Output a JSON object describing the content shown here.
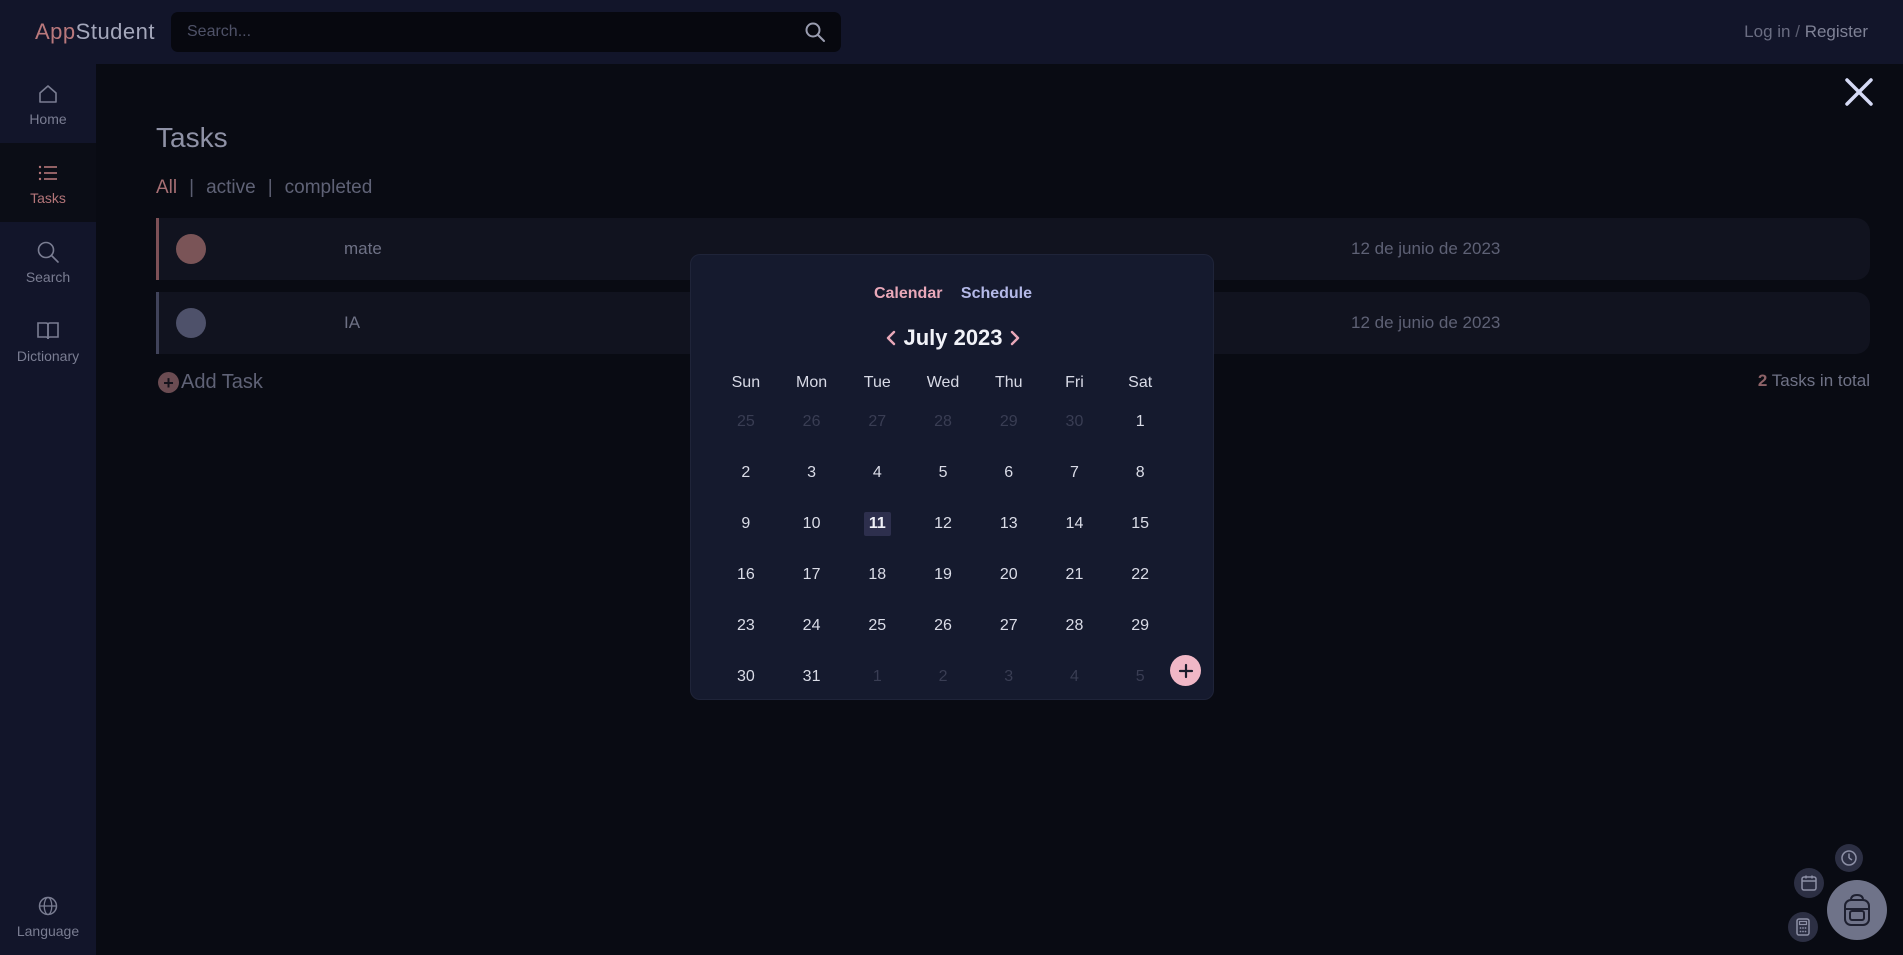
{
  "app": {
    "name_prefix": "App",
    "name_suffix": "Student"
  },
  "search": {
    "placeholder": "Search..."
  },
  "auth": {
    "login": "Log in",
    "separator": "/",
    "register": "Register"
  },
  "sidebar": {
    "items": [
      {
        "label": "Home",
        "icon": "home-icon"
      },
      {
        "label": "Tasks",
        "icon": "list-icon",
        "active": true
      },
      {
        "label": "Search",
        "icon": "search-icon"
      },
      {
        "label": "Dictionary",
        "icon": "book-icon"
      }
    ],
    "language": {
      "label": "Language",
      "icon": "globe-icon"
    }
  },
  "tasks": {
    "title": "Tasks",
    "filters": {
      "all": "All",
      "active": "active",
      "completed": "completed",
      "separator": "|"
    },
    "items": [
      {
        "name": "mate",
        "date": "12 de junio de 2023"
      },
      {
        "name": "IA",
        "date": "12 de junio de 2023"
      }
    ],
    "add_label": "Add Task",
    "total_count": "2",
    "total_label": "Tasks in total"
  },
  "calendar": {
    "tab_calendar": "Calendar",
    "tab_schedule": "Schedule",
    "month_label": "July 2023",
    "weekdays": [
      "Sun",
      "Mon",
      "Tue",
      "Wed",
      "Thu",
      "Fri",
      "Sat"
    ],
    "weeks": [
      [
        "25",
        "26",
        "27",
        "28",
        "29",
        "30",
        "1"
      ],
      [
        "2",
        "3",
        "4",
        "5",
        "6",
        "7",
        "8"
      ],
      [
        "9",
        "10",
        "11",
        "12",
        "13",
        "14",
        "15"
      ],
      [
        "16",
        "17",
        "18",
        "19",
        "20",
        "21",
        "22"
      ],
      [
        "23",
        "24",
        "25",
        "26",
        "27",
        "28",
        "29"
      ],
      [
        "30",
        "31",
        "1",
        "2",
        "3",
        "4",
        "5"
      ]
    ],
    "today": "11"
  },
  "colors": {
    "accent": "#b47579",
    "calendar_tab_active": "#e9a8b9",
    "calendar_tab_inactive": "#b4b9e8",
    "add_button": "#f0b7c6"
  }
}
